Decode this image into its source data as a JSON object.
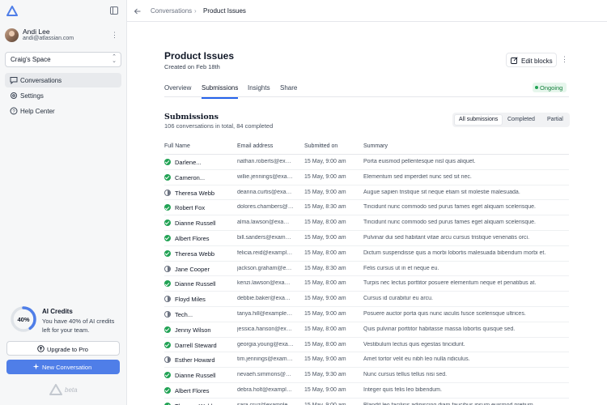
{
  "sidebar": {
    "user": {
      "name": "Andi Lee",
      "email": "andi@atlassian.com"
    },
    "space": "Craig's Space",
    "nav": [
      {
        "label": "Conversations",
        "icon": "chat-icon",
        "active": true
      },
      {
        "label": "Settings",
        "icon": "gear-icon",
        "active": false
      },
      {
        "label": "Help Center",
        "icon": "help-icon",
        "active": false
      }
    ],
    "credits": {
      "percent_label": "40%",
      "used_fraction": 0.4,
      "title": "AI Credits",
      "description": "You have 40% of AI credits left for your team."
    },
    "upgrade_label": "Upgrade to Pro",
    "new_conversation_label": "New Conversation",
    "beta_label": "beta"
  },
  "breadcrumb": {
    "parent": "Conversations",
    "separator": "›",
    "current": "Product Issues"
  },
  "page": {
    "title": "Product Issues",
    "created": "Created on Feb 18th",
    "edit_label": "Edit blocks",
    "tabs": [
      {
        "label": "Overview",
        "active": false
      },
      {
        "label": "Submissions",
        "active": true
      },
      {
        "label": "Insights",
        "active": false
      },
      {
        "label": "Share",
        "active": false
      }
    ],
    "status": "Ongoing",
    "status_color": "#22a355"
  },
  "submissions": {
    "title": "Submissions",
    "summary": "106 conversations in total, 84 completed",
    "filters": [
      {
        "label": "All submissions",
        "active": true
      },
      {
        "label": "Completed",
        "active": false
      },
      {
        "label": "Partial",
        "active": false
      }
    ],
    "columns": [
      "Full Name",
      "Email address",
      "Submitted on",
      "Summary"
    ],
    "rows": [
      {
        "name": "Darlene...",
        "email": "nathan.roberts@example.com",
        "date": "15 May, 9:00 am",
        "summary": "Porta euismod pellentesque nisl quis aliquet.",
        "status": "complete"
      },
      {
        "name": "Cameron...",
        "email": "willie.jennings@example.com",
        "date": "15 May, 9:00 am",
        "summary": "Elementum sed imperdiet nunc sed sit nec.",
        "status": "complete"
      },
      {
        "name": "Theresa Webb",
        "email": "deanna.curtis@example.com",
        "date": "15 May, 9:00 am",
        "summary": "Augue sapien tristique sit neque etiam sit molestie malesuada.",
        "status": "partial"
      },
      {
        "name": "Robert Fox",
        "email": "dolores.chambers@example.com",
        "date": "15 May, 8:30 am",
        "summary": "Tincidunt nunc commodo sed purus fames eget aliquam scelerisque.",
        "status": "complete"
      },
      {
        "name": "Dianne Russell",
        "email": "alma.lawson@example.com",
        "date": "15 May, 8:00 am",
        "summary": "Tincidunt nunc commodo sed purus fames eget aliquam scelerisque.",
        "status": "complete"
      },
      {
        "name": "Albert Flores",
        "email": "bill.sanders@example.com",
        "date": "15 May, 9:00 am",
        "summary": "Pulvinar dui sed habitant vitae arcu cursus tristique venenatis orci.",
        "status": "complete"
      },
      {
        "name": "Theresa Webb",
        "email": "felicia.reid@example.com",
        "date": "15 May, 8:00 am",
        "summary": "Dictum suspendisse quis a morbi lobortis malesuada bibendum morbi et.",
        "status": "complete"
      },
      {
        "name": "Jane Cooper",
        "email": "jackson.graham@example.com",
        "date": "15 May, 8:30 am",
        "summary": "Felis cursus ut in et neque eu.",
        "status": "partial"
      },
      {
        "name": "Dianne Russell",
        "email": "kenzi.lawson@example.com",
        "date": "15 May, 8:00 am",
        "summary": "Turpis nec lectus porttitor posuere elementum neque et penatibus at.",
        "status": "complete"
      },
      {
        "name": "Floyd Miles",
        "email": "debbie.baker@example.com",
        "date": "15 May, 9:00 am",
        "summary": "Cursus id curabitur eu arcu.",
        "status": "partial"
      },
      {
        "name": "Tech...",
        "email": "tanya.hill@example.com",
        "date": "15 May, 9:00 am",
        "summary": "Posuere auctor porta quis nunc iaculis fusce scelerisque ultrices.",
        "status": "partial"
      },
      {
        "name": "Jenny Wilson",
        "email": "jessica.hanson@example.com",
        "date": "15 May, 8:00 am",
        "summary": "Quis pulvinar porttitor habitasse massa lobortis quisque sed.",
        "status": "complete"
      },
      {
        "name": "Darrell Steward",
        "email": "georgia.young@example.com",
        "date": "15 May, 8:00 am",
        "summary": "Vestibulum lectus quis egestas tincidunt.",
        "status": "complete"
      },
      {
        "name": "Esther Howard",
        "email": "tim.jennings@example.com",
        "date": "15 May, 9:00 am",
        "summary": "Amet tortor velit eu nibh leo nulla ridiculus.",
        "status": "partial"
      },
      {
        "name": "Dianne Russell",
        "email": "nevaeh.simmons@example.com",
        "date": "15 May, 9:30 am",
        "summary": "Nunc cursus tellus tellus nisi sed.",
        "status": "complete"
      },
      {
        "name": "Albert Flores",
        "email": "debra.holt@example.com",
        "date": "15 May, 9:00 am",
        "summary": "Integer quis felis leo bibendum.",
        "status": "complete"
      },
      {
        "name": "Theresa Webb",
        "email": "sara.cruz@example.com",
        "date": "15 May, 9:00 am",
        "summary": "Blandit leo facilisis adipiscing diam faucibus ipsum euismod pretium.",
        "status": "complete"
      }
    ]
  }
}
